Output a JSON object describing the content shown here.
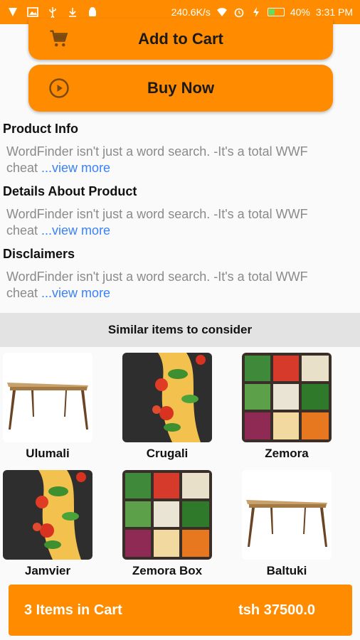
{
  "status_bar": {
    "speed": "240.6K/s",
    "battery_percent": "40%",
    "battery_level": 0.4,
    "time": "3:31 PM",
    "left_icons": [
      "v-app-icon",
      "image-icon",
      "usb-icon",
      "download-icon",
      "android-icon"
    ],
    "right_icons": [
      "wifi-icon",
      "alarm-icon",
      "charging-icon",
      "battery-icon"
    ]
  },
  "actions": {
    "add_to_cart": "Add to Cart",
    "buy_now": "Buy Now"
  },
  "sections": [
    {
      "title": "Product Info",
      "body": "WordFinder isn't just a word search. -It's a total WWF cheat ",
      "more": "...view more"
    },
    {
      "title": "Details About Product",
      "body": "WordFinder isn't just a word search. -It's a total WWF cheat ",
      "more": "...view more"
    },
    {
      "title": "Disclaimers",
      "body": "WordFinder isn't just a word search. -It's a total WWF cheat ",
      "more": "...view more"
    }
  ],
  "similar": {
    "header": "Similar items to consider",
    "items": [
      {
        "name": "Ulumali",
        "image": "table"
      },
      {
        "name": "Crugali",
        "image": "pasta"
      },
      {
        "name": "Zemora",
        "image": "vegetables"
      },
      {
        "name": "Jamvier",
        "image": "pasta"
      },
      {
        "name": "Zemora Box",
        "image": "vegetables"
      },
      {
        "name": "Baltuki",
        "image": "table"
      }
    ]
  },
  "cart": {
    "items_label": "3 Items in Cart",
    "total": "tsh 37500.0"
  },
  "colors": {
    "accent": "#ff8c00",
    "link": "#3b82f6",
    "muted_text": "#8a8a8a",
    "similar_bar_bg": "#e3e3e3"
  }
}
